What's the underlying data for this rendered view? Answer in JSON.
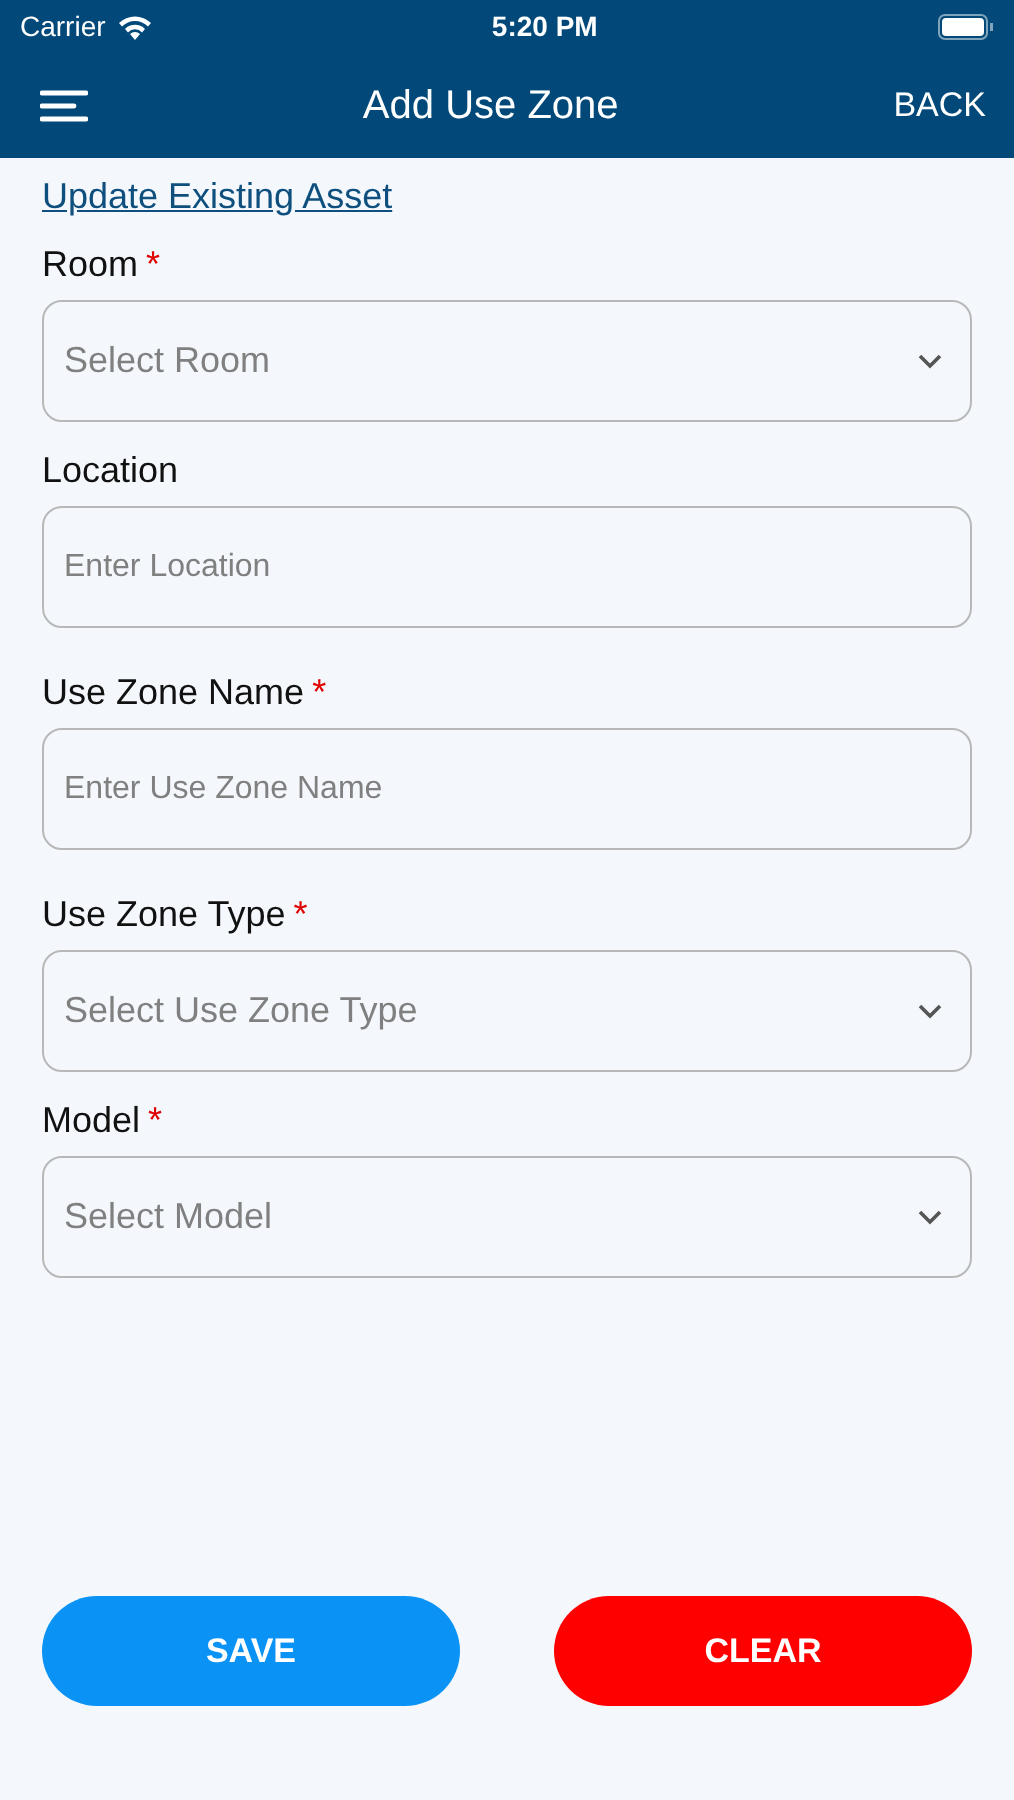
{
  "status_bar": {
    "carrier": "Carrier",
    "time": "5:20 PM"
  },
  "nav": {
    "title": "Add Use Zone",
    "back": "BACK"
  },
  "link": "Update Existing Asset",
  "fields": [
    {
      "kind": "select",
      "label": "Room",
      "required_mark": "*",
      "placeholder": "Select Room"
    },
    {
      "kind": "text",
      "label": "Location",
      "placeholder": "Enter Location"
    },
    {
      "kind": "text",
      "label": "Use Zone Name",
      "required_mark": "*",
      "placeholder": "Enter Use Zone Name"
    },
    {
      "kind": "select",
      "label": "Use Zone Type",
      "required_mark": "*",
      "placeholder": "Select Use Zone Type"
    },
    {
      "kind": "select",
      "label": "Model",
      "required_mark": "*",
      "placeholder": "Select Model"
    }
  ],
  "buttons": [
    {
      "kind": "primary",
      "label": "SAVE"
    },
    {
      "kind": "danger",
      "label": "CLEAR"
    }
  ]
}
